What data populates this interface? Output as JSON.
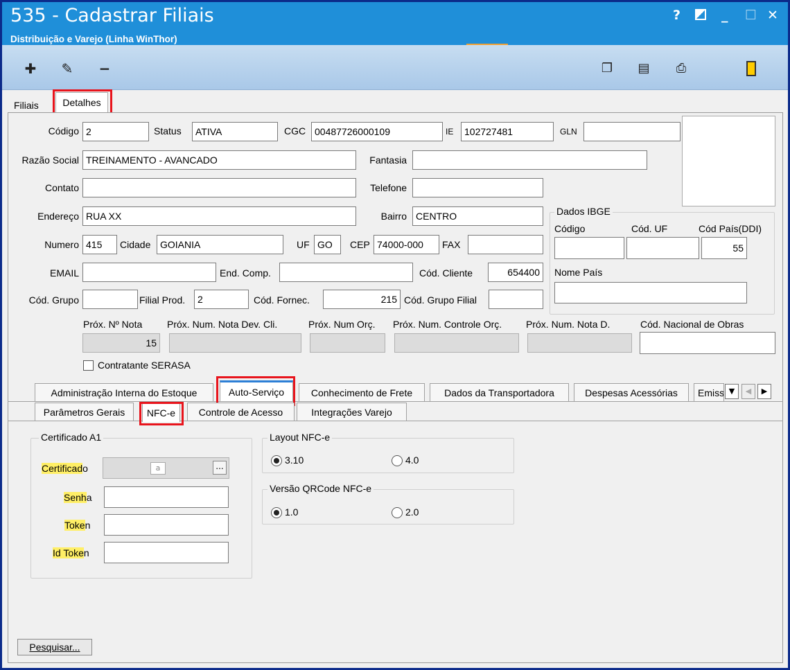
{
  "window": {
    "title": "535 - Cadastrar Filiais",
    "subtitle": "Distribuição e Varejo (Linha WinThor)",
    "help": "?",
    "minimize": "_",
    "maximize": "☐",
    "close": "✕"
  },
  "toolbar": {
    "icons": [
      "add-icon",
      "edit-icon",
      "remove-icon",
      "copy-icon",
      "report-icon",
      "print-icon",
      "exit-icon"
    ]
  },
  "page_tabs": [
    "Filiais",
    "Detalhes"
  ],
  "form": {
    "codigo_label": "Código",
    "codigo": "2",
    "status_label": "Status",
    "status": "ATIVA",
    "cgc_label": "CGC",
    "cgc": "00487726000109",
    "ie_label": "IE",
    "ie": "102727481",
    "gln_label": "GLN",
    "gln": "",
    "razao_label": "Razão Social",
    "razao": "TREINAMENTO - AVANCADO",
    "fantasia_label": "Fantasia",
    "fantasia": "",
    "contato_label": "Contato",
    "contato": "",
    "telefone_label": "Telefone",
    "telefone": "",
    "endereco_label": "Endereço",
    "endereco": "RUA XX",
    "bairro_label": "Bairro",
    "bairro": "CENTRO",
    "numero_label": "Numero",
    "numero": "415",
    "cidade_label": "Cidade",
    "cidade": "GOIANIA",
    "uf_label": "UF",
    "uf": "GO",
    "cep_label": "CEP",
    "cep": "74000-000",
    "fax_label": "FAX",
    "fax": "",
    "email_label": "EMAIL",
    "email": "",
    "endcomp_label": "End. Comp.",
    "endcomp": "",
    "codcliente_label": "Cód. Cliente",
    "codcliente": "654400",
    "codgrupo_label": "Cód. Grupo",
    "codgrupo": "",
    "filialprod_label": "Filial Prod.",
    "filialprod": "2",
    "codfornec_label": "Cód. Fornec.",
    "codfornec": "215",
    "codgrupofilial_label": "Cód. Grupo Filial",
    "codgrupofilial": "",
    "proxnota_label": "Próx. Nº Nota",
    "proxnota": "15",
    "proxdev_label": "Próx. Num. Nota Dev. Cli.",
    "proxorc_label": "Próx. Num Orç.",
    "proxctrl_label": "Próx. Num. Controle Orç.",
    "proxnotad_label": "Próx. Num. Nota D.",
    "codobras_label": "Cód. Nacional de Obras",
    "serasa_label": "Contratante SERASA"
  },
  "ibge": {
    "title": "Dados IBGE",
    "codigo_label": "Código",
    "coduf_label": "Cód. UF",
    "codpais_label": "Cód País(DDI)",
    "codpais": "55",
    "nomepais_label": "Nome País"
  },
  "tabs_row1": [
    "Administração Interna do Estoque",
    "Auto-Serviço",
    "Conhecimento de Frete",
    "Dados da Transportadora",
    "Despesas Acessórias",
    "Emiss"
  ],
  "tabs_row2": [
    "Parâmetros Gerais",
    "NFC-e",
    "Controle de Acesso",
    "Integrações Varejo"
  ],
  "cert": {
    "title": "Certificado A1",
    "certificado_a": "Certificad",
    "certificado_b": "o",
    "senha_a": "Senh",
    "senha_b": "a",
    "token_a": "Toke",
    "token_b": "n",
    "idtoken_a": "Id Toke",
    "idtoken_b": "n",
    "browse": "..."
  },
  "layout": {
    "title": "Layout NFC-e",
    "opt1": "3.10",
    "opt2": "4.0",
    "selected": "3.10"
  },
  "qrcode": {
    "title": "Versão QRCode NFC-e",
    "opt1": "1.0",
    "opt2": "2.0",
    "selected": "1.0"
  },
  "search_button": "Pesquisar..."
}
